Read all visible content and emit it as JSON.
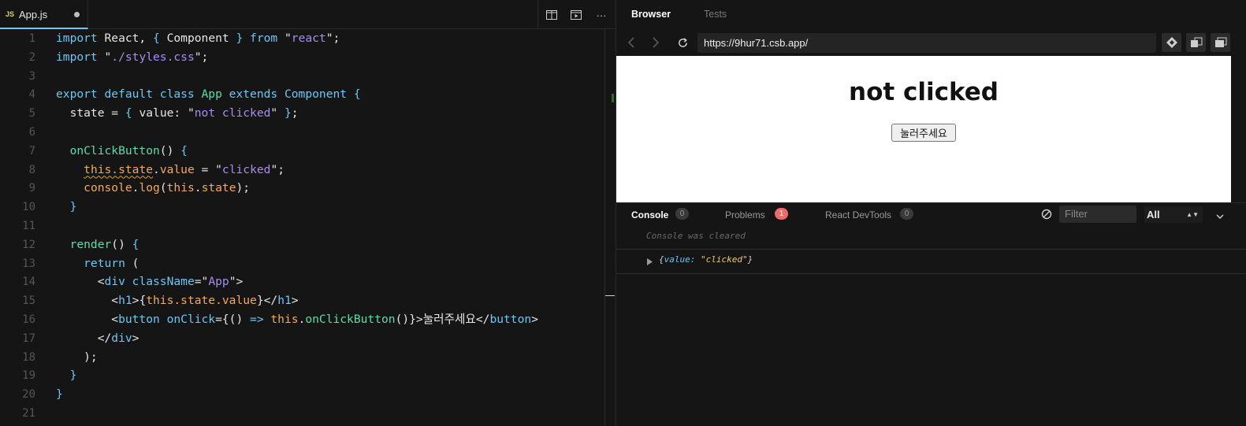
{
  "editor": {
    "file_tab": {
      "badge": "JS",
      "name": "App.js"
    },
    "actions": {
      "split": "split-layout-icon",
      "preview": "open-preview-icon",
      "more": "···"
    },
    "lines": [
      {
        "n": "1",
        "seg": [
          [
            "k",
            "import"
          ],
          [
            "pl",
            " React, "
          ],
          [
            "k",
            "{"
          ],
          [
            "pl",
            " Component "
          ],
          [
            "k",
            "}"
          ],
          [
            "k",
            " from"
          ],
          [
            "pl",
            " \""
          ],
          [
            "s",
            "react"
          ],
          [
            "pl",
            "\";"
          ]
        ]
      },
      {
        "n": "2",
        "seg": [
          [
            "k",
            "import"
          ],
          [
            "pl",
            " \""
          ],
          [
            "s",
            "./styles.css"
          ],
          [
            "pl",
            "\";"
          ]
        ]
      },
      {
        "n": "3",
        "seg": []
      },
      {
        "n": "4",
        "seg": [
          [
            "k",
            "export default class"
          ],
          [
            "fn",
            " App"
          ],
          [
            "k",
            " extends"
          ],
          [
            "k",
            " Component"
          ],
          [
            "k",
            " {"
          ]
        ]
      },
      {
        "n": "5",
        "seg": [
          [
            "pl",
            "  state = "
          ],
          [
            "k",
            "{"
          ],
          [
            "pl",
            " value: \""
          ],
          [
            "s",
            "not clicked"
          ],
          [
            "pl",
            "\" "
          ],
          [
            "k",
            "}"
          ],
          [
            "pl",
            ";"
          ]
        ]
      },
      {
        "n": "6",
        "seg": []
      },
      {
        "n": "7",
        "seg": [
          [
            "fn",
            "  onClickButton"
          ],
          [
            "pl",
            "() "
          ],
          [
            "k",
            "{"
          ]
        ]
      },
      {
        "n": "8",
        "seg": [
          [
            "pl",
            "    "
          ],
          [
            "th squig",
            "this.state"
          ],
          [
            "pl",
            "."
          ],
          [
            "th",
            "value"
          ],
          [
            "pl",
            " = \""
          ],
          [
            "s",
            "clicked"
          ],
          [
            "pl",
            "\";"
          ]
        ]
      },
      {
        "n": "9",
        "seg": [
          [
            "pl",
            "    "
          ],
          [
            "th",
            "console"
          ],
          [
            "pl",
            "."
          ],
          [
            "th",
            "log"
          ],
          [
            "pl",
            "("
          ],
          [
            "th",
            "this"
          ],
          [
            "pl",
            "."
          ],
          [
            "th",
            "state"
          ],
          [
            "pl",
            ");"
          ]
        ]
      },
      {
        "n": "10",
        "seg": [
          [
            "k",
            "  }"
          ]
        ]
      },
      {
        "n": "11",
        "seg": []
      },
      {
        "n": "12",
        "seg": [
          [
            "fn",
            "  render"
          ],
          [
            "pl",
            "() "
          ],
          [
            "k",
            "{"
          ]
        ]
      },
      {
        "n": "13",
        "seg": [
          [
            "k",
            "    return"
          ],
          [
            "pl",
            " ("
          ]
        ]
      },
      {
        "n": "14",
        "seg": [
          [
            "pl",
            "      <"
          ],
          [
            "tg",
            "div"
          ],
          [
            "k",
            " className"
          ],
          [
            "pl",
            "=\""
          ],
          [
            "s",
            "App"
          ],
          [
            "pl",
            "\">"
          ]
        ]
      },
      {
        "n": "15",
        "seg": [
          [
            "pl",
            "        <"
          ],
          [
            "tg",
            "h1"
          ],
          [
            "pl",
            ">{"
          ],
          [
            "th",
            "this.state.value"
          ],
          [
            "pl",
            "}</"
          ],
          [
            "tg",
            "h1"
          ],
          [
            "pl",
            ">"
          ]
        ]
      },
      {
        "n": "16",
        "seg": [
          [
            "pl",
            "        <"
          ],
          [
            "tg",
            "button"
          ],
          [
            "k",
            " onClick"
          ],
          [
            "pl",
            "={() "
          ],
          [
            "k",
            "=>"
          ],
          [
            "th",
            " this"
          ],
          [
            "pl",
            "."
          ],
          [
            "fn",
            "onClickButton"
          ],
          [
            "pl",
            "()}>눌러주세요</"
          ],
          [
            "tg",
            "button"
          ],
          [
            "pl",
            ">"
          ]
        ]
      },
      {
        "n": "17",
        "seg": [
          [
            "pl",
            "      </"
          ],
          [
            "tg",
            "div"
          ],
          [
            "pl",
            ">"
          ]
        ]
      },
      {
        "n": "18",
        "seg": [
          [
            "pl",
            "    );"
          ]
        ]
      },
      {
        "n": "19",
        "seg": [
          [
            "k",
            "  }"
          ]
        ]
      },
      {
        "n": "20",
        "seg": [
          [
            "k",
            "}"
          ]
        ]
      },
      {
        "n": "21",
        "seg": []
      }
    ]
  },
  "browser": {
    "tabs": [
      "Browser",
      "Tests"
    ],
    "url": "https://9hur71.csb.app/",
    "preview": {
      "heading": "not clicked",
      "button_label": "눌러주세요"
    }
  },
  "console": {
    "tabs": [
      {
        "label": "Console",
        "count": "0"
      },
      {
        "label": "Problems",
        "count": "1"
      },
      {
        "label": "React DevTools",
        "count": "0"
      }
    ],
    "filter_placeholder": "Filter",
    "level": "All",
    "cleared_message": "Console was cleared",
    "log_entry": {
      "open": "{",
      "key": "value",
      "sep": ": ",
      "value": "\"clicked\"",
      "close": "}"
    }
  },
  "colors": {
    "accent": "#6cc7f6",
    "error_badge": "#ee6a6a",
    "bg": "#151515"
  }
}
